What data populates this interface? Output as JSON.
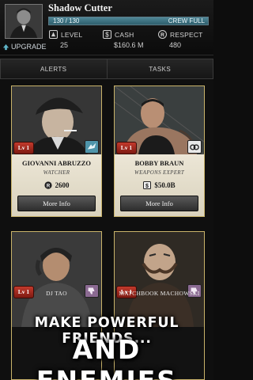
{
  "player": {
    "name": "Shadow Cutter",
    "health": "130 / 130",
    "health_fraction": 1.0,
    "crew_status": "CREW FULL",
    "upgrade_label": "UPGRADE"
  },
  "stats": {
    "level_label": "LEVEL",
    "level_value": "25",
    "cash_label": "CASH",
    "cash_value": "$160.6 M",
    "respect_label": "RESPECT",
    "respect_value": "480"
  },
  "tabs": [
    {
      "label": "ALERTS"
    },
    {
      "label": "TASKS"
    }
  ],
  "cards": [
    {
      "name": "GIOVANNI ABRUZZO",
      "role": "WATCHER",
      "level": "Lv 1",
      "cost": "2600",
      "button": "More Info"
    },
    {
      "name": "BOBBY BRAUN",
      "role": "WEAPONS EXPERT",
      "level": "Lv 1",
      "cost": "$50.0B",
      "button": "More Info"
    },
    {
      "name": "DJ TAO",
      "level": "Lv 1"
    },
    {
      "name": "MATCHBOOK MACHOWSKI",
      "level": "Lv 1"
    }
  ],
  "promo": {
    "line1": "MAKE POWERFUL FRIENDS...",
    "line2": "AND ENEMIES"
  },
  "colors": {
    "card_border": "#c9b36a",
    "level_badge": "#b0291e",
    "hp_bar": "#3e7180",
    "badge_blue": "#4f95ab",
    "badge_purple": "#8b6a92"
  },
  "icons": [
    "avatar-portrait",
    "upgrade-icon",
    "level-icon",
    "cash-icon",
    "respect-icon",
    "watcher-bird-icon",
    "handcuffs-icon",
    "thumbs-down-icon",
    "respect-coin-icon",
    "cash-coin-icon"
  ]
}
